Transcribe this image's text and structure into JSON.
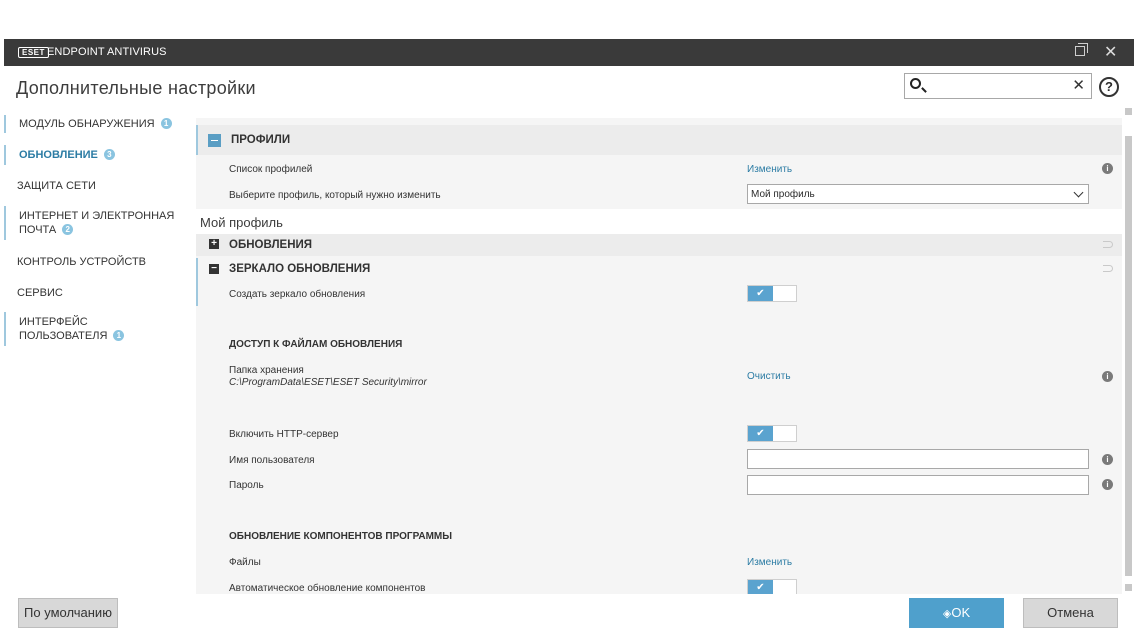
{
  "window": {
    "logo": "ESET",
    "product": "ENDPOINT ANTIVIRUS"
  },
  "header": {
    "title": "Дополнительные настройки",
    "search_value": "",
    "help": "?"
  },
  "sidebar": {
    "items": [
      {
        "label": "МОДУЛЬ ОБНАРУЖЕНИЯ",
        "badge": "1"
      },
      {
        "label": "ОБНОВЛЕНИЕ",
        "badge": "3"
      },
      {
        "label": "ЗАЩИТА СЕТИ",
        "badge": ""
      },
      {
        "label": "ИНТЕРНЕТ И ЭЛЕКТРОННАЯ",
        "label2": "ПОЧТА",
        "badge": "2"
      },
      {
        "label": "КОНТРОЛЬ УСТРОЙСТВ",
        "badge": ""
      },
      {
        "label": "СЕРВИС",
        "badge": ""
      },
      {
        "label": "ИНТЕРФЕЙС",
        "label2": "ПОЛЬЗОВАТЕЛЯ",
        "badge": "1"
      }
    ]
  },
  "profiles": {
    "title": "ПРОФИЛИ",
    "list_label": "Список профилей",
    "list_action": "Изменить",
    "select_label": "Выберите профиль, который нужно изменить",
    "select_value": "Мой профиль"
  },
  "my_profile": {
    "title": "Мой профиль",
    "updates": "ОБНОВЛЕНИЯ",
    "mirror": "ЗЕРКАЛО ОБНОВЛЕНИЯ",
    "create_mirror_label": "Создать зеркало обновления",
    "create_mirror_on": true
  },
  "file_access": {
    "title": "ДОСТУП К ФАЙЛАМ ОБНОВЛЕНИЯ",
    "folder_label": "Папка хранения",
    "folder_path": "C:\\ProgramData\\ESET\\ESET Security\\mirror",
    "folder_action": "Очистить",
    "http_label": "Включить HTTP-сервер",
    "http_on": true,
    "user_label": "Имя пользователя",
    "user_value": "",
    "password_label": "Пароль",
    "password_value": ""
  },
  "components": {
    "title": "ОБНОВЛЕНИЕ КОМПОНЕНТОВ ПРОГРАММЫ",
    "files_label": "Файлы",
    "files_action": "Изменить",
    "auto_label": "Автоматическое обновление компонентов",
    "auto_on": true
  },
  "footer": {
    "default_label": "По умолчанию",
    "ok_label": "OK",
    "cancel_label": "Отмена"
  },
  "glyphs": {
    "check": "✔",
    "info": "i",
    "close": "✕",
    "plus": "+",
    "minus": "−",
    "shield": "◈"
  },
  "colors": {
    "accent": "#2c7ca4",
    "toggle_on": "#5aa3cf",
    "titlebar": "#3a3a3a"
  }
}
